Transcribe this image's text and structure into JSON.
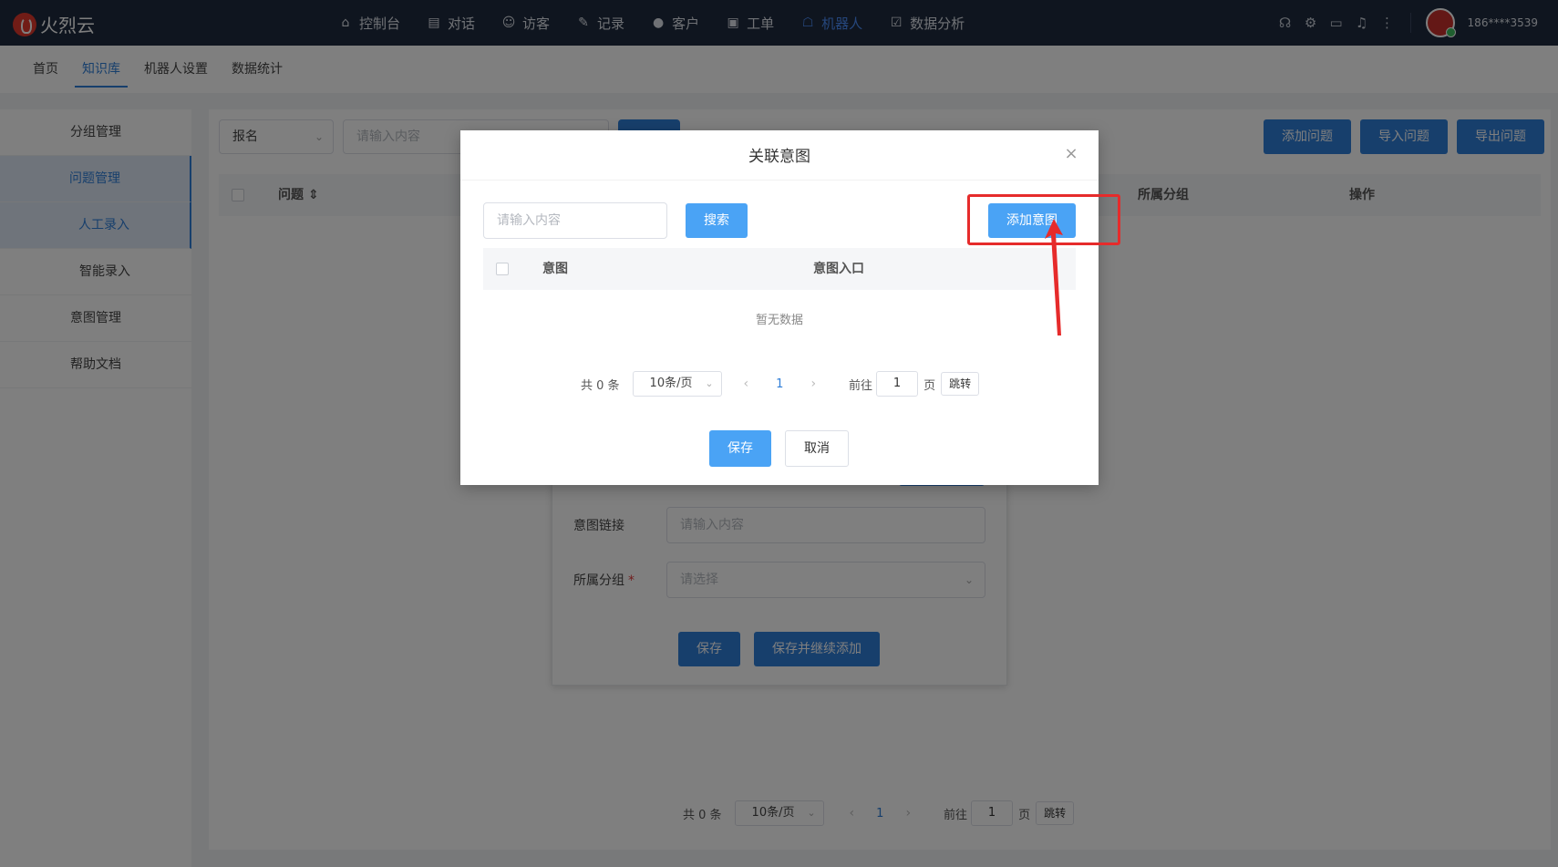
{
  "app": {
    "logo_text": "火烈云"
  },
  "topnav": {
    "items": [
      {
        "label": "控制台",
        "icon": "home-icon"
      },
      {
        "label": "对话",
        "icon": "chat-icon"
      },
      {
        "label": "访客",
        "icon": "visitors-icon"
      },
      {
        "label": "记录",
        "icon": "record-icon"
      },
      {
        "label": "客户",
        "icon": "customer-icon"
      },
      {
        "label": "工单",
        "icon": "ticket-icon"
      },
      {
        "label": "机器人",
        "icon": "robot-icon",
        "active": true
      },
      {
        "label": "数据分析",
        "icon": "analytics-icon"
      }
    ],
    "username": "186****3539"
  },
  "subtabs": [
    "首页",
    "知识库",
    "机器人设置",
    "数据统计"
  ],
  "sidebar": {
    "items": [
      "分组管理",
      "问题管理",
      "人工录入",
      "智能录入",
      "意图管理",
      "帮助文档"
    ]
  },
  "main": {
    "filter_select": "报名",
    "filter_placeholder": "请输入内容",
    "buttons": [
      "添加问题",
      "导入问题",
      "导出问题"
    ],
    "table_headers": {
      "question": "问题",
      "group": "所属分组",
      "action": "操作"
    },
    "pager": {
      "total": "共 0 条",
      "size": "10条/页",
      "page": "1",
      "goto": "前往",
      "goto_value": "1",
      "page_unit": "页",
      "jump": "跳转"
    }
  },
  "form_card": {
    "intent_link_label": "意图链接",
    "intent_link_placeholder": "请输入内容",
    "group_label": "所属分组",
    "group_required": "*",
    "group_placeholder": "请选择",
    "save": "保存",
    "save_continue": "保存并继续添加"
  },
  "dialog": {
    "title": "关联意图",
    "search_placeholder": "请输入内容",
    "search_button": "搜索",
    "add_button": "添加意图",
    "col_intent": "意图",
    "col_entry": "意图入口",
    "empty": "暂无数据",
    "pager": {
      "total": "共 0 条",
      "size": "10条/页",
      "page": "1",
      "goto": "前往",
      "goto_value": "1",
      "page_unit": "页",
      "jump": "跳转"
    },
    "save": "保存",
    "cancel": "取消"
  },
  "colors": {
    "topbar": "#1f2b3f",
    "accent": "#2f7ed8",
    "dialog_button": "#4aa3f5",
    "highlight": "#e62b2b"
  }
}
